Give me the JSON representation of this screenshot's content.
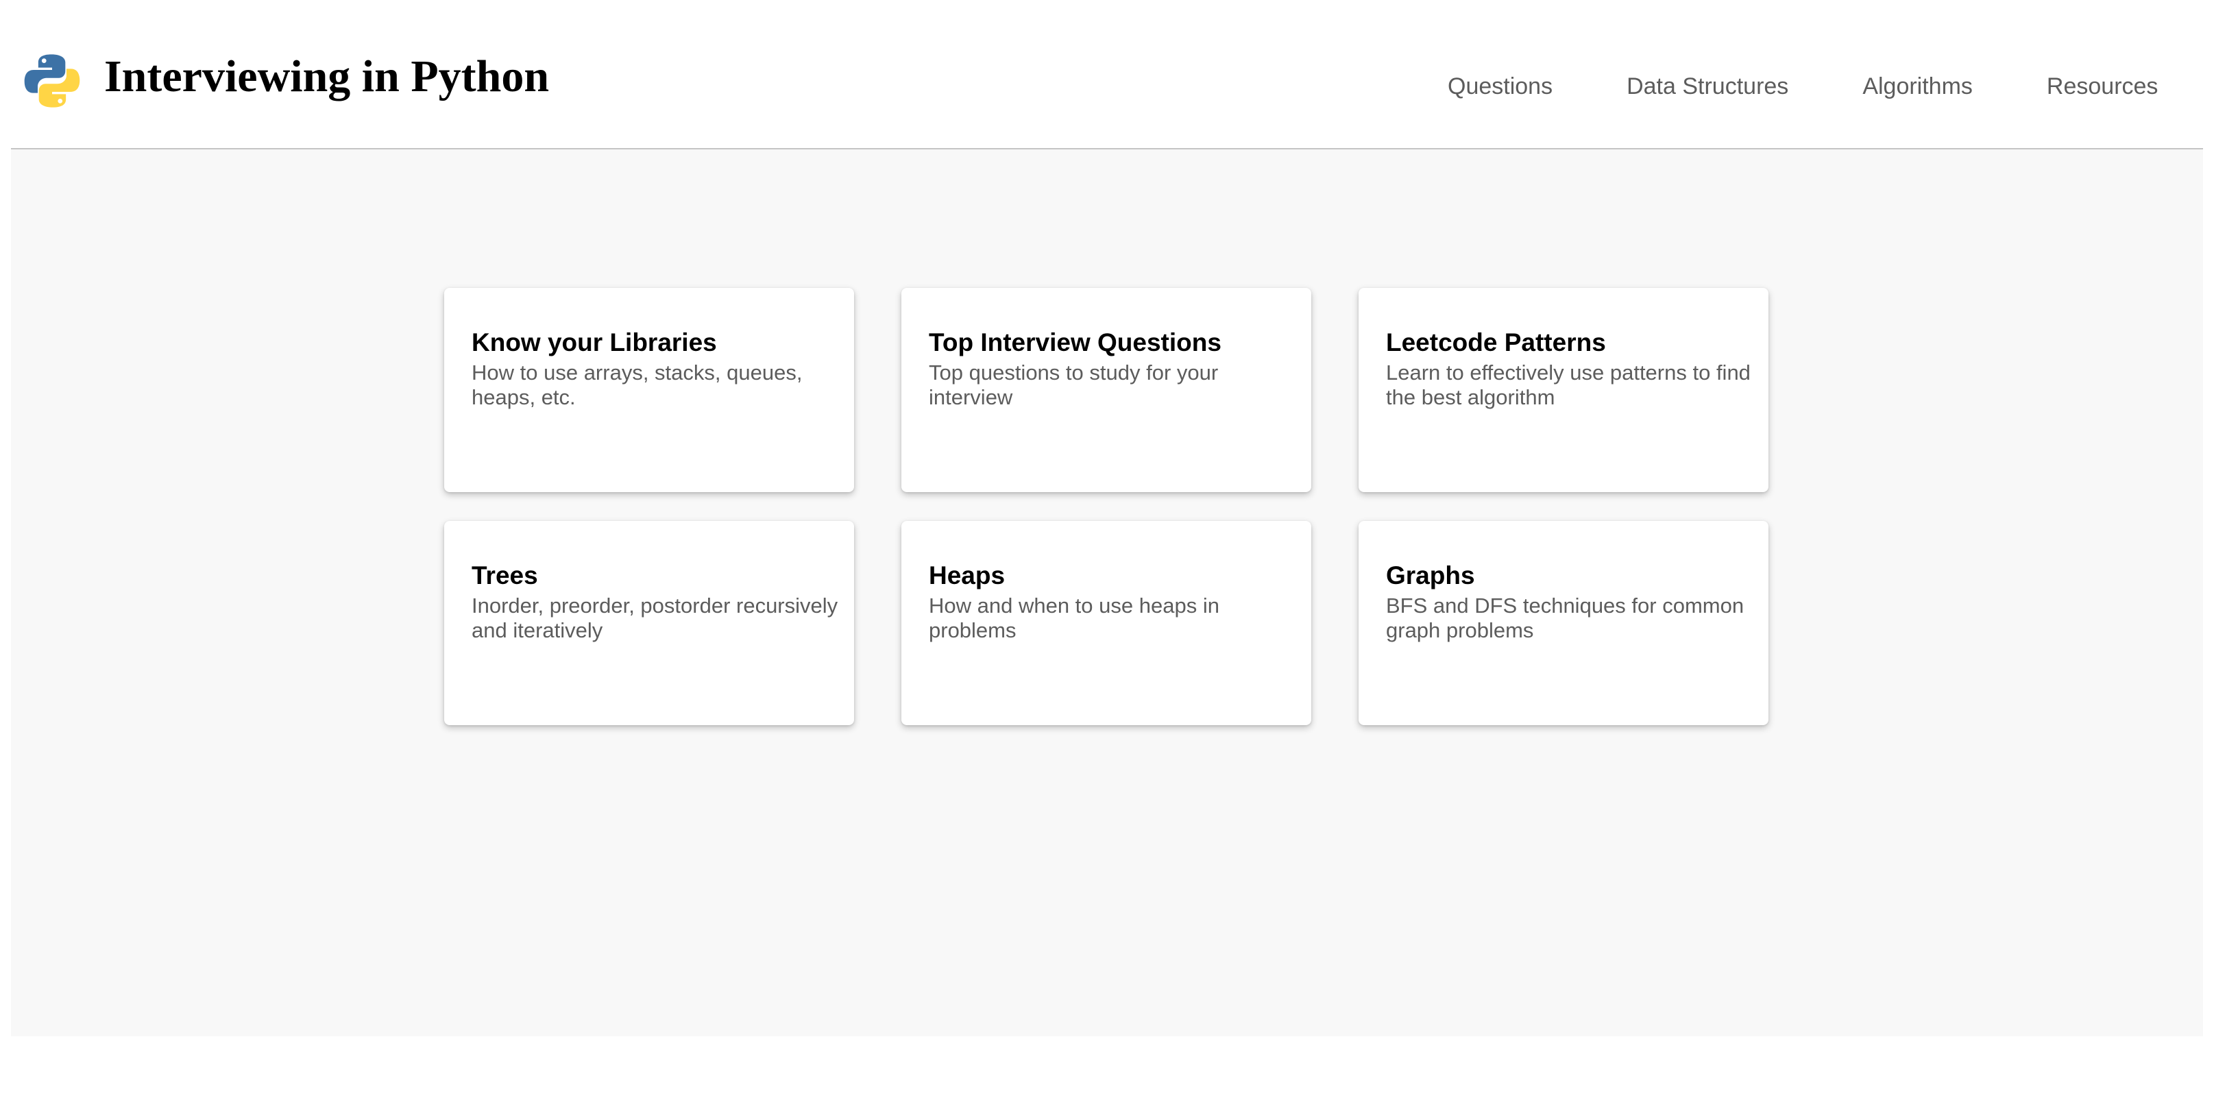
{
  "header": {
    "title": "Interviewing in Python",
    "logo_icon": "python-logo-icon",
    "nav": [
      {
        "label": "Questions"
      },
      {
        "label": "Data Structures"
      },
      {
        "label": "Algorithms"
      },
      {
        "label": "Resources"
      }
    ]
  },
  "cards": [
    {
      "title": "Know your Libraries",
      "description": "How to use arrays, stacks, queues, heaps, etc."
    },
    {
      "title": "Top Interview Questions",
      "description": "Top questions to study for your interview"
    },
    {
      "title": "Leetcode Patterns",
      "description": "Learn to effectively use patterns to find the best algorithm"
    },
    {
      "title": "Trees",
      "description": "Inorder, preorder, postorder recursively and iteratively"
    },
    {
      "title": "Heaps",
      "description": "How and when to use heaps in problems"
    },
    {
      "title": "Graphs",
      "description": "BFS and DFS techniques for common graph problems"
    }
  ],
  "colors": {
    "background": "#f8f8f8",
    "card": "#ffffff",
    "nav_text": "#5c5c5c",
    "python_blue": "#3d72a6",
    "python_yellow": "#ffd545"
  }
}
